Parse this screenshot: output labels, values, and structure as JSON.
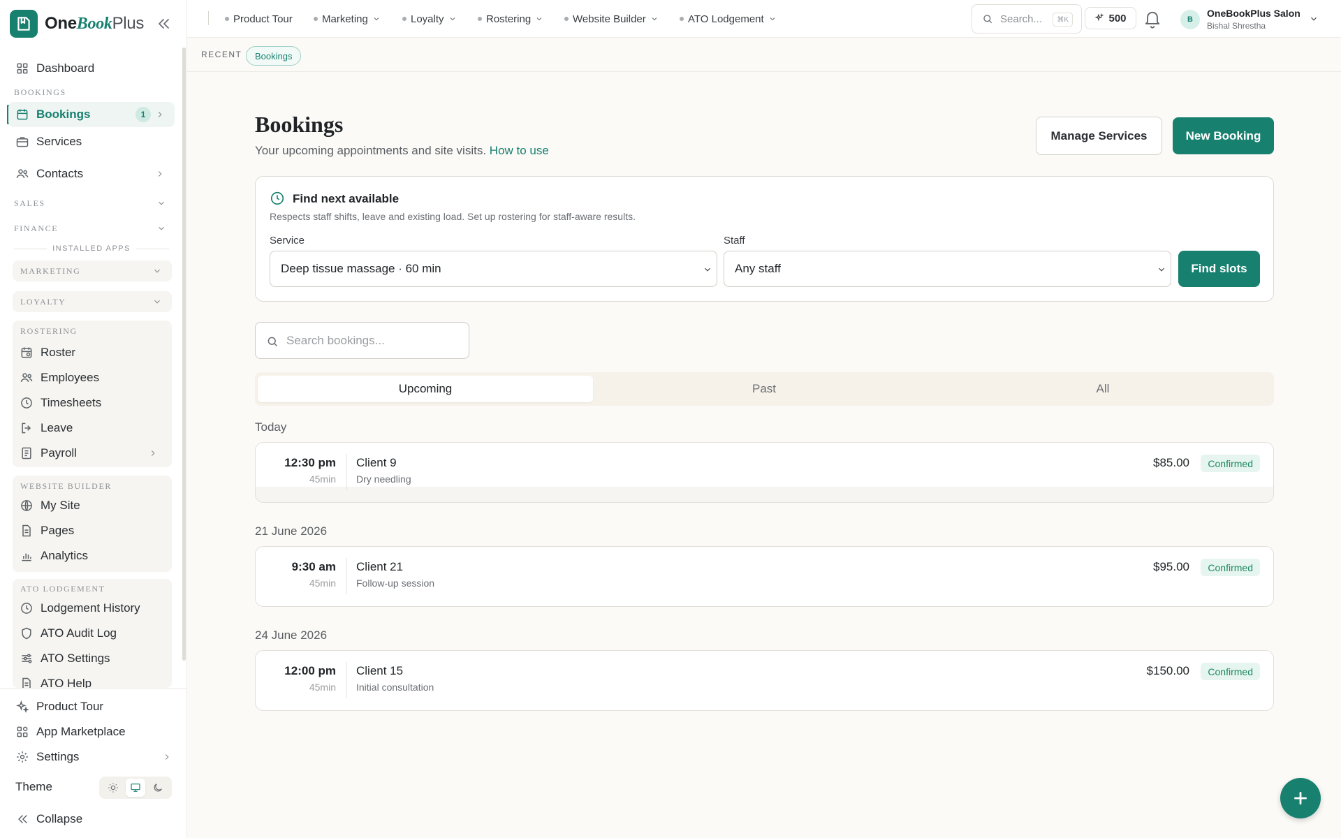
{
  "brand": {
    "one": "One",
    "book": "Book",
    "plus": "Plus"
  },
  "sidebar": {
    "dashboard": "Dashboard",
    "bookings_section": "BOOKINGS",
    "bookings": "Bookings",
    "bookings_count": "1",
    "services": "Services",
    "contacts": "Contacts",
    "sales": "SALES",
    "finance": "FINANCE",
    "installed_apps": "INSTALLED APPS",
    "marketing": "MARKETING",
    "loyalty": "LOYALTY",
    "rostering": {
      "title": "ROSTERING",
      "items": [
        "Roster",
        "Employees",
        "Timesheets",
        "Leave",
        "Payroll"
      ]
    },
    "website_builder": {
      "title": "WEBSITE BUILDER",
      "items": [
        "My Site",
        "Pages",
        "Analytics"
      ]
    },
    "ato_lodgement": {
      "title": "ATO LODGEMENT",
      "items": [
        "Lodgement History",
        "ATO Audit Log",
        "ATO Settings",
        "ATO Help"
      ]
    },
    "bottom": {
      "product_tour": "Product Tour",
      "app_marketplace": "App Marketplace",
      "settings": "Settings",
      "theme": "Theme",
      "collapse": "Collapse"
    }
  },
  "topbar": {
    "nav": [
      "Product Tour",
      "Marketing",
      "Loyalty",
      "Rostering",
      "Website Builder",
      "ATO Lodgement"
    ],
    "search_placeholder": "Search...",
    "search_shortcut": "⌘K",
    "credits": "500",
    "user_initial": "B",
    "user_name": "OneBookPlus Salon",
    "user_sub": "Bishal Shrestha"
  },
  "recent": {
    "label": "RECENT",
    "chip": "Bookings"
  },
  "page": {
    "title": "Bookings",
    "subtitle": "Your upcoming appointments and site visits.",
    "how_to": "How to use",
    "manage_services": "Manage Services",
    "new_booking": "New Booking"
  },
  "finder": {
    "title": "Find next available",
    "description": "Respects staff shifts, leave and existing load. Set up rostering for staff-aware results.",
    "service_label": "Service",
    "service_value": "Deep tissue massage · 60 min",
    "staff_label": "Staff",
    "staff_value": "Any staff",
    "find_button": "Find slots"
  },
  "search_bookings": {
    "placeholder": "Search bookings..."
  },
  "tabs": [
    "Upcoming",
    "Past",
    "All"
  ],
  "groups": [
    {
      "date": "Today",
      "bookings": [
        {
          "time": "12:30 pm",
          "duration": "45min",
          "client": "Client 9",
          "service": "Dry needling",
          "price": "$85.00",
          "status": "Confirmed"
        }
      ]
    },
    {
      "date": "21 June 2026",
      "bookings": [
        {
          "time": "9:30 am",
          "duration": "45min",
          "client": "Client 21",
          "service": "Follow-up session",
          "price": "$95.00",
          "status": "Confirmed"
        }
      ]
    },
    {
      "date": "24 June 2026",
      "bookings": [
        {
          "time": "12:00 pm",
          "duration": "45min",
          "client": "Client 15",
          "service": "Initial consultation",
          "price": "$150.00",
          "status": "Confirmed"
        }
      ]
    }
  ],
  "colors": {
    "accent": "#17806f",
    "status_confirmed_bg": "#e6f5ef",
    "status_confirmed_text": "#1c8a5e"
  }
}
